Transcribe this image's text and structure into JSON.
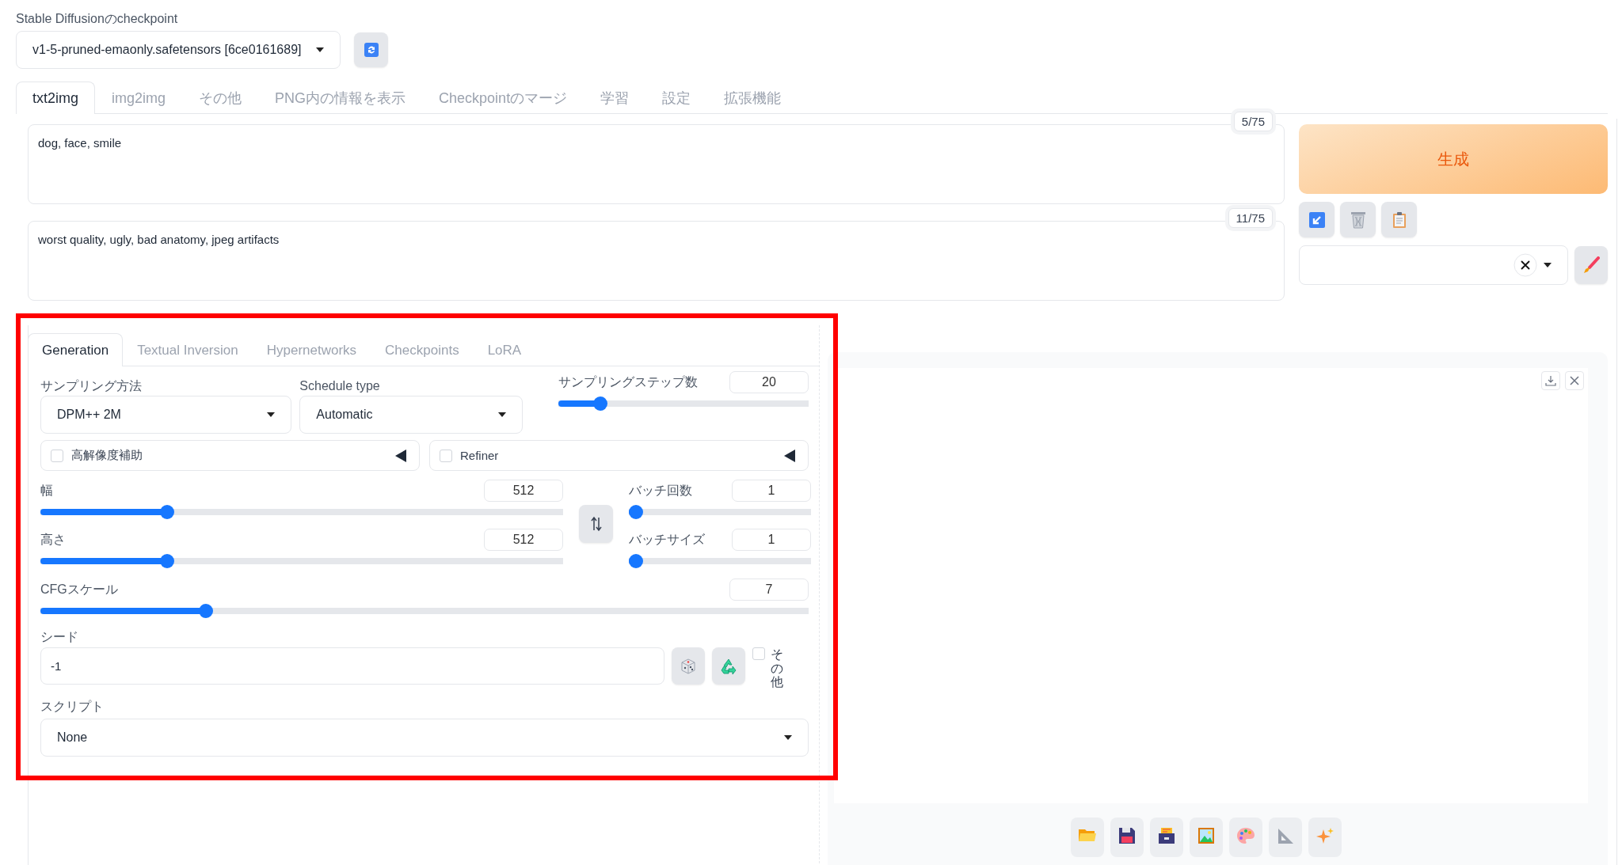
{
  "checkpoint": {
    "label": "Stable Diffusionのcheckpoint",
    "value": "v1-5-pruned-emaonly.safetensors [6ce0161689]"
  },
  "tabs": [
    {
      "label": "txt2img",
      "selected": true
    },
    {
      "label": "img2img",
      "selected": false
    },
    {
      "label": "その他",
      "selected": false
    },
    {
      "label": "PNG内の情報を表示",
      "selected": false
    },
    {
      "label": "Checkpointのマージ",
      "selected": false
    },
    {
      "label": "学習",
      "selected": false
    },
    {
      "label": "設定",
      "selected": false
    },
    {
      "label": "拡張機能",
      "selected": false
    }
  ],
  "prompt": {
    "value": "dog, face, smile",
    "counter": "5/75"
  },
  "negative_prompt": {
    "value": "worst quality, ugly, bad anatomy, jpeg artifacts",
    "counter": "11/75"
  },
  "generate_button": "生成",
  "subtabs": [
    {
      "label": "Generation",
      "selected": true
    },
    {
      "label": "Textual Inversion",
      "selected": false
    },
    {
      "label": "Hypernetworks",
      "selected": false
    },
    {
      "label": "Checkpoints",
      "selected": false
    },
    {
      "label": "LoRA",
      "selected": false
    }
  ],
  "sampling_method": {
    "label": "サンプリング方法",
    "value": "DPM++ 2M"
  },
  "schedule_type": {
    "label": "Schedule type",
    "value": "Automatic"
  },
  "sampling_steps": {
    "label": "サンプリングステップ数",
    "value": "20",
    "level": 0.15
  },
  "hires_fix": {
    "label": "高解像度補助",
    "checked": false
  },
  "refiner": {
    "label": "Refiner",
    "checked": false
  },
  "width": {
    "label": "幅",
    "value": "512",
    "level": 0.235
  },
  "height": {
    "label": "高さ",
    "value": "512",
    "level": 0.235
  },
  "batch_count": {
    "label": "バッチ回数",
    "value": "1",
    "level": 0.0
  },
  "batch_size": {
    "label": "バッチサイズ",
    "value": "1",
    "level": 0.0
  },
  "cfg_scale": {
    "label": "CFGスケール",
    "value": "7",
    "level": 0.21
  },
  "seed": {
    "label": "シード",
    "value": "-1"
  },
  "extra": {
    "label": "その他",
    "checked": false
  },
  "script": {
    "label": "スクリプト",
    "value": "None"
  }
}
